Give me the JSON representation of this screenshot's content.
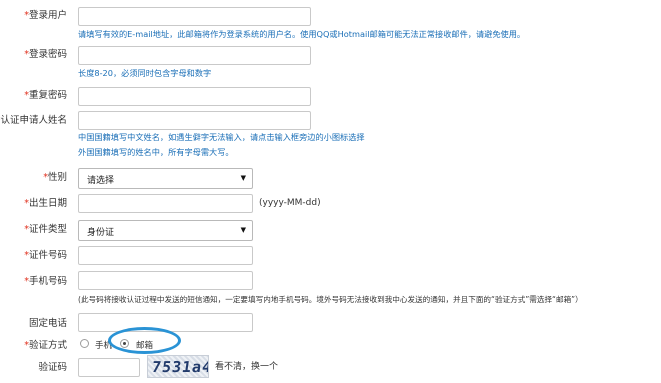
{
  "fields": {
    "username": {
      "required": true,
      "label": "登录用户"
    },
    "password": {
      "required": true,
      "label": "登录密码"
    },
    "confirm_password": {
      "required": true,
      "label": "重复密码"
    },
    "applicant_name": {
      "required": true,
      "label": "认证申请人姓名"
    },
    "gender": {
      "required": true,
      "label": "性别",
      "selected": "请选择"
    },
    "birth_date": {
      "required": true,
      "label": "出生日期",
      "format_hint": "(yyyy-MM-dd)"
    },
    "id_type": {
      "required": true,
      "label": "证件类型",
      "selected": "身份证"
    },
    "id_number": {
      "required": true,
      "label": "证件号码"
    },
    "mobile": {
      "required": true,
      "label": "手机号码"
    },
    "landline": {
      "required": false,
      "label": "固定电话"
    },
    "verify_method": {
      "required": true,
      "label": "验证方式",
      "options": [
        "手机",
        "邮箱"
      ],
      "selected": "邮箱"
    },
    "captcha": {
      "required": false,
      "label": "验证码",
      "image_text": "7531a4",
      "refresh_text": "看不清，换一个"
    }
  },
  "hints": {
    "username": "请填写有效的E-mail地址，此邮箱将作为登录系统的用户名。使用QQ或Hotmail邮箱可能无法正常接收邮件，请避免使用。",
    "password": "长度8-20，必须同时包含字母和数字",
    "name_line1": "中国国籍填写中文姓名，如遇生僻字无法输入，请点击输入框旁边的小图标选择",
    "name_line2": "外国国籍填写的姓名中，所有字母需大写。",
    "mobile": "(此号码将接收认证过程中发送的短信通知，一定要填写内地手机号码。境外号码无法接收到我中心发送的通知，并且下面的“验证方式”需选择“邮箱”）"
  },
  "star": "*",
  "caret": "▼"
}
